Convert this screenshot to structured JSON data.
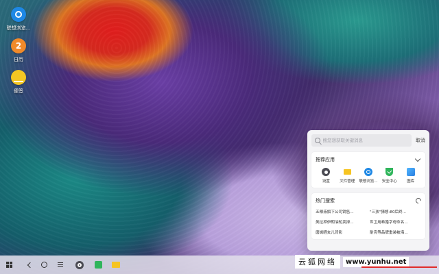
{
  "desktop": {
    "icons": [
      {
        "label": "联想浏览...",
        "icon": "browser-icon",
        "color": "#1e88e5"
      },
      {
        "label": "日历",
        "icon": "calendar-icon",
        "color": "#f08a2a",
        "badge_text": "2"
      },
      {
        "label": "便签",
        "icon": "note-icon",
        "color": "#f3c623"
      }
    ]
  },
  "search_panel": {
    "placeholder": "搜您想获取关键消息",
    "cancel_label": "取消",
    "recommended": {
      "title": "推荐应用",
      "apps": [
        {
          "label": "设置",
          "icon": "settings-icon"
        },
        {
          "label": "文件管理",
          "icon": "folder-icon"
        },
        {
          "label": "联想浏览...",
          "icon": "browser-icon"
        },
        {
          "label": "安全中心",
          "icon": "shield-icon"
        },
        {
          "label": "图库",
          "icon": "gallery-icon"
        }
      ]
    },
    "hot": {
      "title": "热门搜索",
      "items": [
        "五粮液旗下公司销售...",
        "\"三孩\"猜想:80后终...",
        "美拉押伊朗油轮卖掉...",
        "世卫用希腊字母命名...",
        "唐嫣晒女儿背影",
        "耐克等品牌重装被海..."
      ]
    }
  },
  "taskbar": {
    "buttons": [
      "start-icon",
      "back-icon",
      "home-icon",
      "menu-icon",
      "settings-icon",
      "security-icon",
      "folder-icon"
    ]
  },
  "watermark": {
    "cn": "云狐网络",
    "url": "www.yunhu.net"
  }
}
